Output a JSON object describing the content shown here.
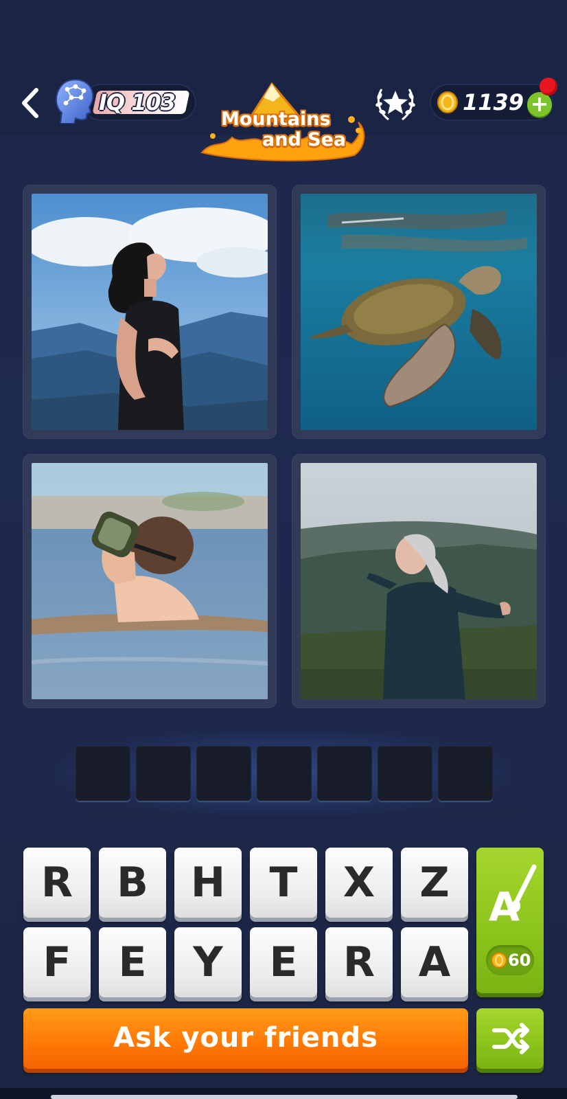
{
  "header": {
    "iq_label": "IQ 103",
    "coins": "1139",
    "level_title_line1": "Mountains",
    "level_title_line2": "and Sea"
  },
  "puzzle": {
    "answer_length": 7,
    "images": [
      {
        "name": "woman-breathing-mountains"
      },
      {
        "name": "sea-turtle-underwater"
      },
      {
        "name": "boy-swimming-snorkel-mask"
      },
      {
        "name": "elderly-woman-arms-open"
      }
    ]
  },
  "keyboard": {
    "row1": [
      "R",
      "B",
      "H",
      "T",
      "X",
      "Z"
    ],
    "row2": [
      "F",
      "E",
      "Y",
      "E",
      "R",
      "A"
    ]
  },
  "hint": {
    "cost": "60"
  },
  "actions": {
    "ask_label": "Ask your friends"
  },
  "colors": {
    "background": "#1d2749",
    "ask_button": "#ff7a06",
    "hint_button": "#8bc31c",
    "notification": "#e8161e"
  }
}
